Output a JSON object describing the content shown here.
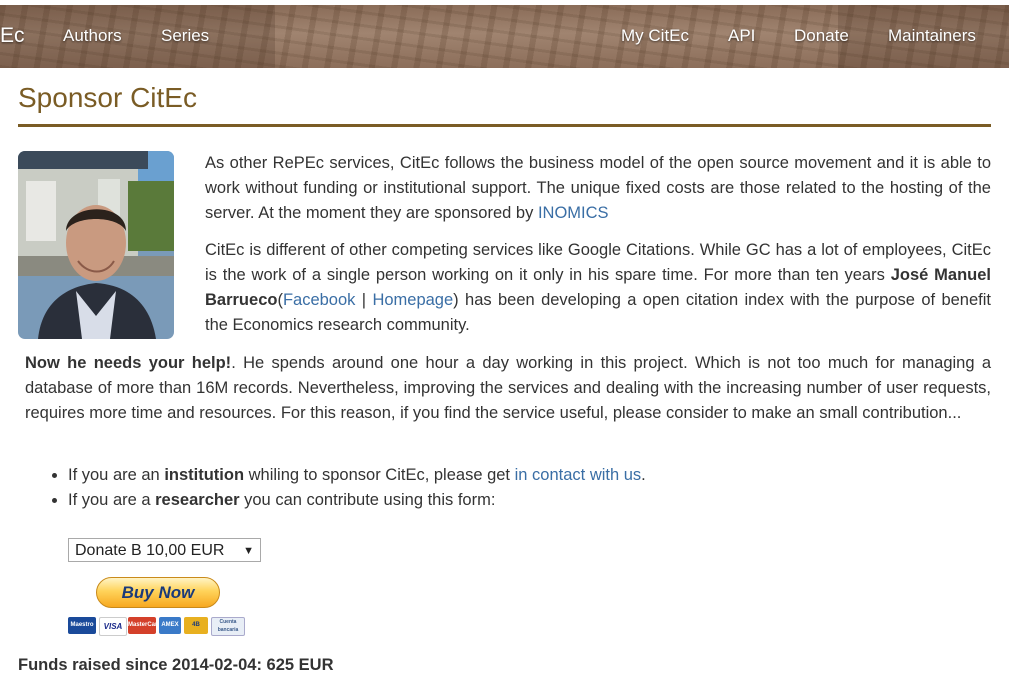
{
  "nav": {
    "brand": "Ec",
    "left": [
      "Authors",
      "Series"
    ],
    "right": [
      "My CitEc",
      "API",
      "Donate",
      "Maintainers"
    ]
  },
  "page_title": "Sponsor CitEc",
  "intro": {
    "p1": "As other RePEc services, CitEc follows the business model of the open source movement and it is able to work without funding or institutional support. The unique fixed costs are those related to the hosting of the server. At the moment they are sponsored by ",
    "p1_link": "INOMICS",
    "p2_a": "CitEc is different of other competing services like Google Citations. While GC has a lot of employees, CitEc is the work of a single person working on it only in his spare time. For more than ten years ",
    "p2_name": "José Manuel Barrueco",
    "p2_paren_open": "(",
    "p2_facebook": "Facebook",
    "p2_sep": " | ",
    "p2_homepage": "Homepage",
    "p2_b": ") has been developing a open citation index with the purpose of benefit the Economics research community."
  },
  "help": {
    "bold": "Now he needs your help!",
    "text": ". He spends around one hour a day working in this project. Which is not too much for managing a database of more than 16M records. Nevertheless, improving the services and dealing with the increasing number of user requests, requires more time and resources. For this reason, if you find the service useful, please consider to make an small contribution..."
  },
  "options": {
    "inst_pre": "If you are an ",
    "inst_bold": "institution",
    "inst_mid": " whiling to sponsor CitEc, please get ",
    "inst_link": "in contact with us",
    "inst_end": ".",
    "res_pre": "If you are a ",
    "res_bold": "researcher",
    "res_end": " you can contribute using this form:"
  },
  "donate_select": {
    "value": "Donate B 10,00 EUR"
  },
  "buy_button": "Buy Now",
  "cards": [
    "Maestro",
    "VISA",
    "MasterCard",
    "AMEX",
    "4B",
    "Cuenta bancaria"
  ],
  "funds": "Funds raised since 2014-02-04: 625 EUR"
}
